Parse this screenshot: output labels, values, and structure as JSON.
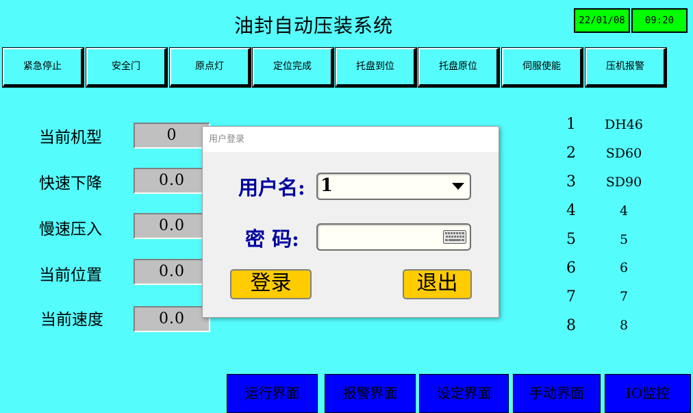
{
  "app": {
    "title": "油封自动压装系统",
    "date": "22/01/08",
    "time": "09:20"
  },
  "status_buttons": [
    {
      "label": "紧急停止"
    },
    {
      "label": "安全门"
    },
    {
      "label": "原点灯"
    },
    {
      "label": "定位完成"
    },
    {
      "label": "托盘到位"
    },
    {
      "label": "托盘原位"
    },
    {
      "label": "伺服使能"
    },
    {
      "label": "压机报警"
    }
  ],
  "params": [
    {
      "label": "当前机型",
      "value": "0"
    },
    {
      "label": "快速下降",
      "value": "0.0"
    },
    {
      "label": "慢速压入",
      "value": "0.0"
    },
    {
      "label": "当前位置",
      "value": "0.0"
    },
    {
      "label": "当前速度",
      "value": "0.0"
    }
  ],
  "models": [
    {
      "num": "1",
      "name": "DH46"
    },
    {
      "num": "2",
      "name": "SD60"
    },
    {
      "num": "3",
      "name": "SD90"
    },
    {
      "num": "4",
      "name": "4"
    },
    {
      "num": "5",
      "name": "5"
    },
    {
      "num": "6",
      "name": "6"
    },
    {
      "num": "7",
      "name": "7"
    },
    {
      "num": "8",
      "name": "8"
    }
  ],
  "nav": [
    {
      "label": "运行界面"
    },
    {
      "label": "报警界面"
    },
    {
      "label": "设定界面"
    },
    {
      "label": "手动界面"
    },
    {
      "label": "IO监控"
    }
  ],
  "login_dialog": {
    "title": "用户登录",
    "username_label": "用户名:",
    "username_value": "1",
    "password_label": "密 码:",
    "password_value": "",
    "login_button": "登录",
    "exit_button": "退出",
    "keyboard_icon": "keyboard-icon",
    "dropdown_icon": "chevron-down-icon"
  },
  "colors": {
    "background": "#55fcfc",
    "clock": "#00ff00",
    "nav": "#0000ff",
    "dialog_button": "#ffcc00",
    "dialog_label": "#0000a0"
  }
}
